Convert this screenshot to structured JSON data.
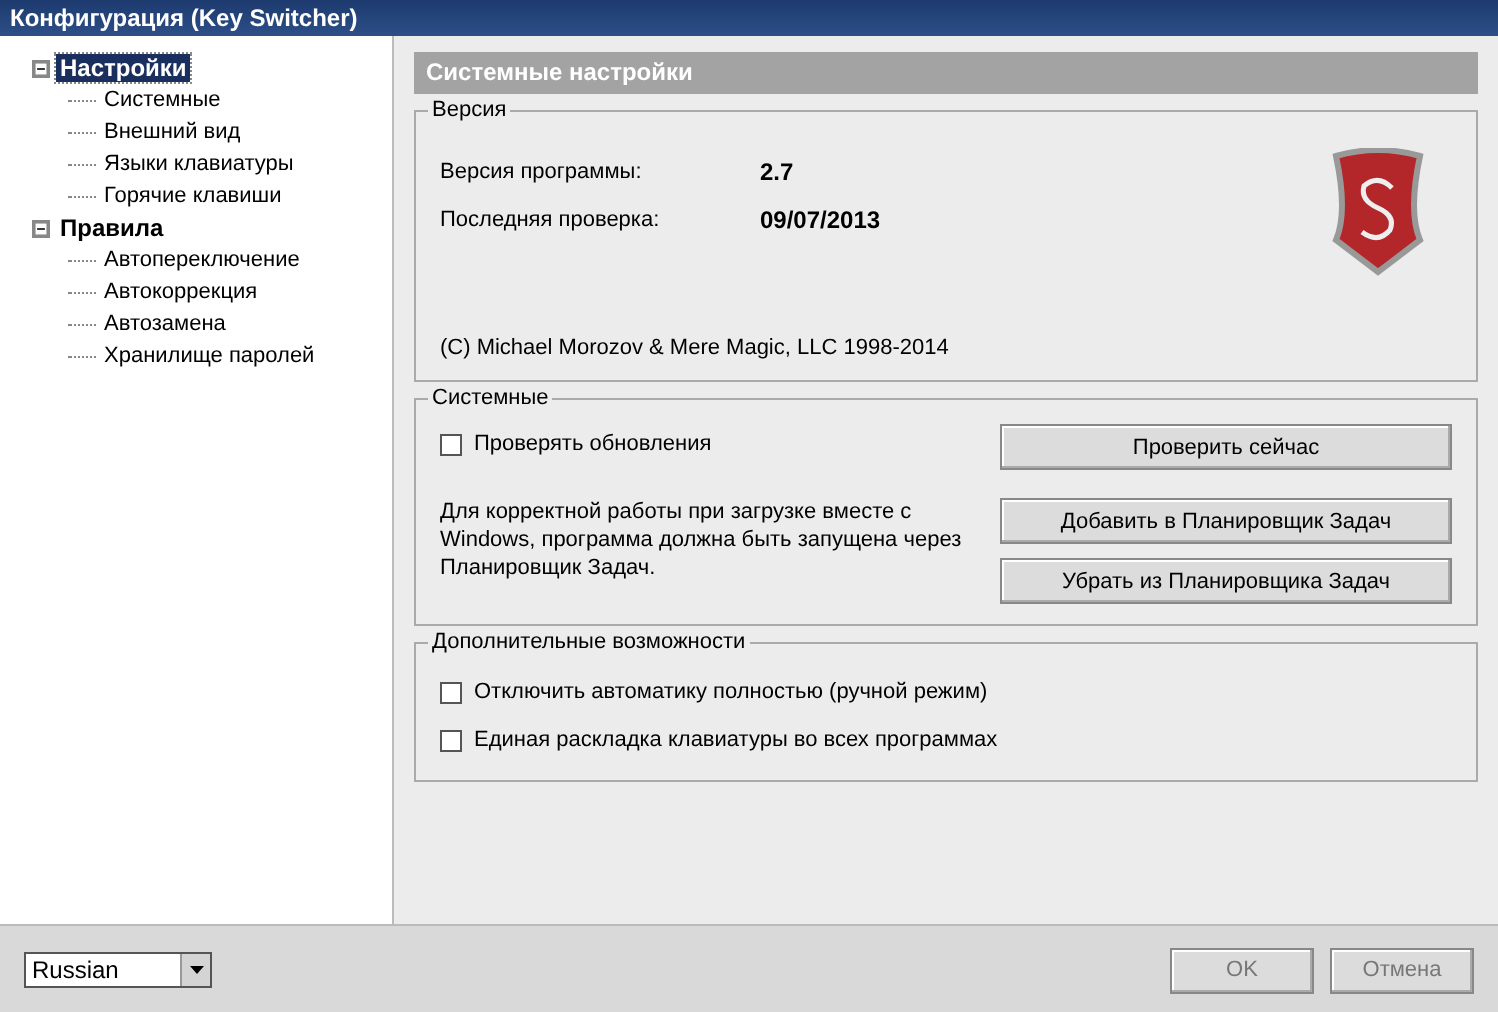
{
  "window": {
    "title": "Конфигурация (Key Switcher)"
  },
  "tree": [
    {
      "label": "Настройки",
      "selected": true,
      "expanded": true,
      "children": [
        {
          "label": "Системные",
          "selected": false
        },
        {
          "label": "Внешний вид",
          "selected": false
        },
        {
          "label": "Языки клавиатуры",
          "selected": false
        },
        {
          "label": "Горячие клавиши",
          "selected": false
        }
      ]
    },
    {
      "label": "Правила",
      "selected": false,
      "expanded": true,
      "children": [
        {
          "label": "Автопереключение",
          "selected": false
        },
        {
          "label": "Автокоррекция",
          "selected": false
        },
        {
          "label": "Автозамена",
          "selected": false
        },
        {
          "label": "Хранилище паролей",
          "selected": false
        }
      ]
    }
  ],
  "page_title": "Системные настройки",
  "version_group": {
    "title": "Версия",
    "rows": [
      {
        "label": "Версия программы:",
        "value": "2.7"
      },
      {
        "label": "Последняя проверка:",
        "value": "09/07/2013"
      }
    ],
    "copyright": "(C) Michael Morozov & Mere Magic, LLC 1998-2014"
  },
  "system_group": {
    "title": "Системные",
    "check": {
      "label": "Проверять обновления",
      "checked": false
    },
    "check_button": "Проверить сейчас",
    "note": "Для корректной работы при загрузке вместе с Windows, программа должна быть запущена через Планировщик Задач.",
    "buttons": [
      "Добавить в Планировщик Задач",
      "Убрать из Планировщика Задач"
    ]
  },
  "extra_group": {
    "title": "Дополнительные возможности",
    "checks": [
      {
        "label": "Отключить автоматику полностью (ручной режим)",
        "checked": false
      },
      {
        "label": "Единая раскладка клавиатуры во всех программах",
        "checked": false
      }
    ]
  },
  "language_select": {
    "value": "Russian"
  },
  "footer_buttons": [
    "OK",
    "Отмена"
  ]
}
